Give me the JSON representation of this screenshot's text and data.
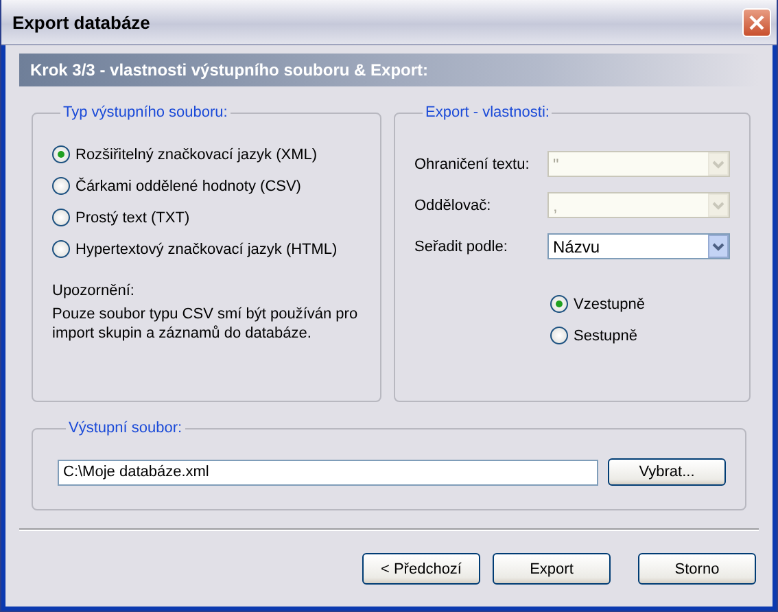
{
  "window": {
    "title": "Export databáze"
  },
  "header": "Krok 3/3 - vlastnosti výstupního souboru & Export:",
  "format_group": {
    "legend": "Typ výstupního souboru:",
    "options": [
      {
        "label": "Rozšiřitelný značkovací jazyk (XML)",
        "selected": true
      },
      {
        "label": "Čárkami oddělené hodnoty (CSV)",
        "selected": false
      },
      {
        "label": "Prostý text (TXT)",
        "selected": false
      },
      {
        "label": "Hypertextový značkovací jazyk (HTML)",
        "selected": false
      }
    ],
    "note_title": "Upozornění:",
    "note": "Pouze soubor typu CSV smí být používán pro import skupin a záznamů do databáze."
  },
  "export_group": {
    "legend": "Export - vlastnosti:",
    "fields": [
      {
        "label": "Ohraničení textu:",
        "value": "\"",
        "disabled": true
      },
      {
        "label": "Oddělovač:",
        "value": ",",
        "disabled": true
      },
      {
        "label": "Seřadit podle:",
        "value": "Názvu",
        "disabled": false
      }
    ],
    "order": [
      {
        "label": "Vzestupně",
        "selected": true
      },
      {
        "label": "Sestupně",
        "selected": false
      }
    ]
  },
  "output_group": {
    "legend": "Výstupní soubor:",
    "path": "C:\\Moje databáze.xml",
    "browse": "Vybrat..."
  },
  "buttons": [
    "< Předchozí",
    "Export",
    "Storno"
  ]
}
